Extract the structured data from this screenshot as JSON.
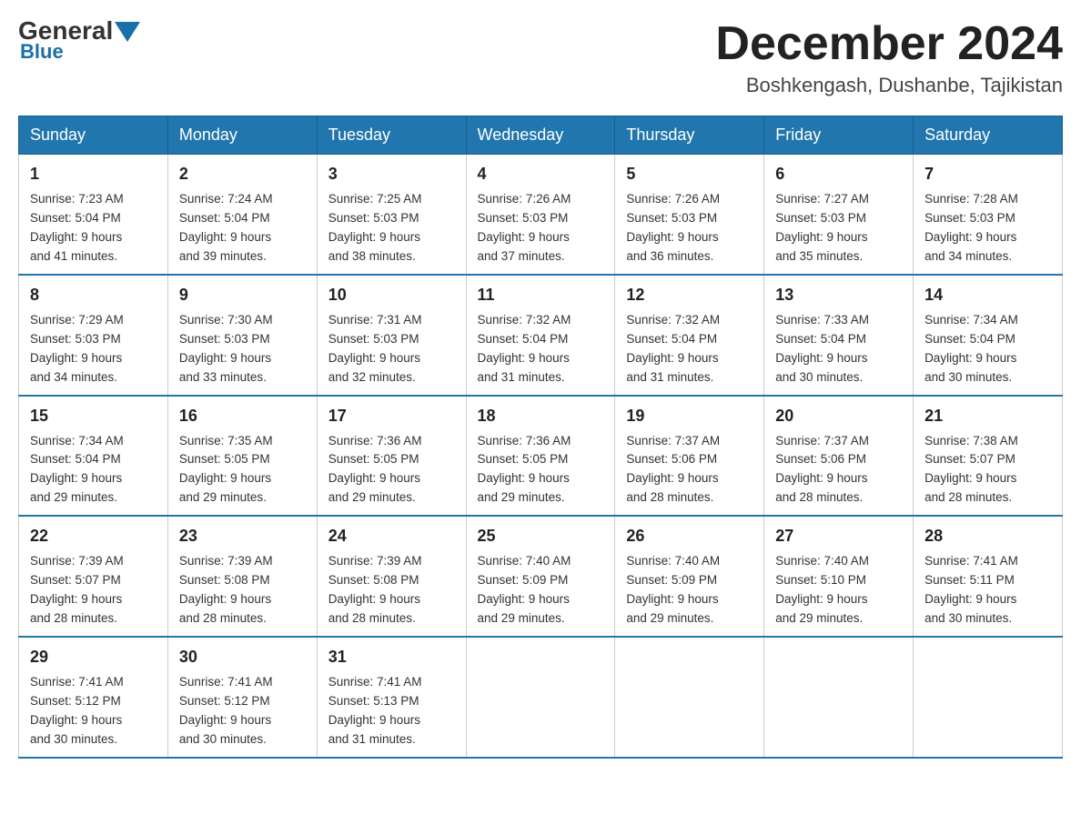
{
  "header": {
    "logo": {
      "general": "General",
      "blue": "Blue"
    },
    "title": "December 2024",
    "subtitle": "Boshkengash, Dushanbe, Tajikistan"
  },
  "columns": [
    "Sunday",
    "Monday",
    "Tuesday",
    "Wednesday",
    "Thursday",
    "Friday",
    "Saturday"
  ],
  "weeks": [
    [
      {
        "day": "1",
        "sunrise": "7:23 AM",
        "sunset": "5:04 PM",
        "daylight": "9 hours and 41 minutes."
      },
      {
        "day": "2",
        "sunrise": "7:24 AM",
        "sunset": "5:04 PM",
        "daylight": "9 hours and 39 minutes."
      },
      {
        "day": "3",
        "sunrise": "7:25 AM",
        "sunset": "5:03 PM",
        "daylight": "9 hours and 38 minutes."
      },
      {
        "day": "4",
        "sunrise": "7:26 AM",
        "sunset": "5:03 PM",
        "daylight": "9 hours and 37 minutes."
      },
      {
        "day": "5",
        "sunrise": "7:26 AM",
        "sunset": "5:03 PM",
        "daylight": "9 hours and 36 minutes."
      },
      {
        "day": "6",
        "sunrise": "7:27 AM",
        "sunset": "5:03 PM",
        "daylight": "9 hours and 35 minutes."
      },
      {
        "day": "7",
        "sunrise": "7:28 AM",
        "sunset": "5:03 PM",
        "daylight": "9 hours and 34 minutes."
      }
    ],
    [
      {
        "day": "8",
        "sunrise": "7:29 AM",
        "sunset": "5:03 PM",
        "daylight": "9 hours and 34 minutes."
      },
      {
        "day": "9",
        "sunrise": "7:30 AM",
        "sunset": "5:03 PM",
        "daylight": "9 hours and 33 minutes."
      },
      {
        "day": "10",
        "sunrise": "7:31 AM",
        "sunset": "5:03 PM",
        "daylight": "9 hours and 32 minutes."
      },
      {
        "day": "11",
        "sunrise": "7:32 AM",
        "sunset": "5:04 PM",
        "daylight": "9 hours and 31 minutes."
      },
      {
        "day": "12",
        "sunrise": "7:32 AM",
        "sunset": "5:04 PM",
        "daylight": "9 hours and 31 minutes."
      },
      {
        "day": "13",
        "sunrise": "7:33 AM",
        "sunset": "5:04 PM",
        "daylight": "9 hours and 30 minutes."
      },
      {
        "day": "14",
        "sunrise": "7:34 AM",
        "sunset": "5:04 PM",
        "daylight": "9 hours and 30 minutes."
      }
    ],
    [
      {
        "day": "15",
        "sunrise": "7:34 AM",
        "sunset": "5:04 PM",
        "daylight": "9 hours and 29 minutes."
      },
      {
        "day": "16",
        "sunrise": "7:35 AM",
        "sunset": "5:05 PM",
        "daylight": "9 hours and 29 minutes."
      },
      {
        "day": "17",
        "sunrise": "7:36 AM",
        "sunset": "5:05 PM",
        "daylight": "9 hours and 29 minutes."
      },
      {
        "day": "18",
        "sunrise": "7:36 AM",
        "sunset": "5:05 PM",
        "daylight": "9 hours and 29 minutes."
      },
      {
        "day": "19",
        "sunrise": "7:37 AM",
        "sunset": "5:06 PM",
        "daylight": "9 hours and 28 minutes."
      },
      {
        "day": "20",
        "sunrise": "7:37 AM",
        "sunset": "5:06 PM",
        "daylight": "9 hours and 28 minutes."
      },
      {
        "day": "21",
        "sunrise": "7:38 AM",
        "sunset": "5:07 PM",
        "daylight": "9 hours and 28 minutes."
      }
    ],
    [
      {
        "day": "22",
        "sunrise": "7:39 AM",
        "sunset": "5:07 PM",
        "daylight": "9 hours and 28 minutes."
      },
      {
        "day": "23",
        "sunrise": "7:39 AM",
        "sunset": "5:08 PM",
        "daylight": "9 hours and 28 minutes."
      },
      {
        "day": "24",
        "sunrise": "7:39 AM",
        "sunset": "5:08 PM",
        "daylight": "9 hours and 28 minutes."
      },
      {
        "day": "25",
        "sunrise": "7:40 AM",
        "sunset": "5:09 PM",
        "daylight": "9 hours and 29 minutes."
      },
      {
        "day": "26",
        "sunrise": "7:40 AM",
        "sunset": "5:09 PM",
        "daylight": "9 hours and 29 minutes."
      },
      {
        "day": "27",
        "sunrise": "7:40 AM",
        "sunset": "5:10 PM",
        "daylight": "9 hours and 29 minutes."
      },
      {
        "day": "28",
        "sunrise": "7:41 AM",
        "sunset": "5:11 PM",
        "daylight": "9 hours and 30 minutes."
      }
    ],
    [
      {
        "day": "29",
        "sunrise": "7:41 AM",
        "sunset": "5:12 PM",
        "daylight": "9 hours and 30 minutes."
      },
      {
        "day": "30",
        "sunrise": "7:41 AM",
        "sunset": "5:12 PM",
        "daylight": "9 hours and 30 minutes."
      },
      {
        "day": "31",
        "sunrise": "7:41 AM",
        "sunset": "5:13 PM",
        "daylight": "9 hours and 31 minutes."
      },
      null,
      null,
      null,
      null
    ]
  ],
  "labels": {
    "sunrise": "Sunrise: ",
    "sunset": "Sunset: ",
    "daylight": "Daylight: "
  }
}
